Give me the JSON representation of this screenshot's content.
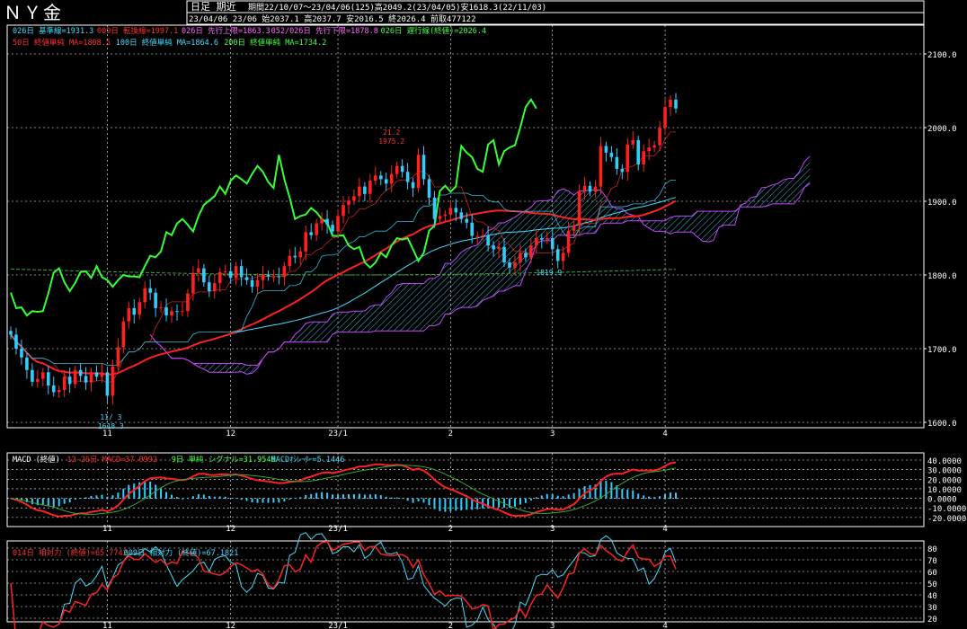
{
  "title": "ＮＹ金",
  "header": {
    "period_label": "日足 期近",
    "range_info": "期間22/10/07〜23/04/06(125)高2049.2(23/04/05)安1618.3(22/11/03)",
    "last_bar": "23/04/06 23/06 始2037.1 高2037.7 安2016.5 終2026.4 前取477122"
  },
  "indicators_row1": [
    {
      "text": "026日 基準線=1931.3",
      "color": "#44ddff"
    },
    {
      "text": "009日 転換線=1997.1",
      "color": "#ff3030"
    },
    {
      "text": "026日 先行上限=1863.3",
      "color": "#ff66ff"
    },
    {
      "text": "052/026日 先行下限=1878.8",
      "color": "#ff66ff"
    },
    {
      "text": "026日 遅行線(終値)=2026.4",
      "color": "#44ff44"
    }
  ],
  "indicators_row2": [
    {
      "text": "50日 終値単純 MA=1808.5",
      "color": "#ff3030"
    },
    {
      "text": "100日 終値単純 MA=1864.6",
      "color": "#44ddff"
    },
    {
      "text": "200日 終値単純 MA=1734.2",
      "color": "#44ff44"
    }
  ],
  "macd_legend": [
    {
      "text": "MACD (終値)",
      "color": "#ffffff"
    },
    {
      "text": "12-26日 MACD=37.0992",
      "color": "#ff3030"
    },
    {
      "text": "9日 単純 シグナル=31.9546",
      "color": "#44ff44"
    },
    {
      "text": "MACDｵｼﾚｰﾀｰ=5.1446",
      "color": "#44ddff"
    }
  ],
  "rsi_legend": [
    {
      "text": "014日 相対力 (終値)=65.7742",
      "color": "#ff3030"
    },
    {
      "text": "009日 相対力 (終値)=67.1821",
      "color": "#44ddff"
    }
  ],
  "annotations": [
    {
      "text": "11/ 3",
      "color": "#44ddff"
    },
    {
      "text": "1618.3",
      "color": "#44ddff"
    },
    {
      "text": "21.2",
      "color": "#ff3030"
    },
    {
      "text": "1975.2",
      "color": "#ff3030"
    },
    {
      "text": "1819.9",
      "color": "#44ddff"
    }
  ],
  "colors": {
    "up": "#ff2020",
    "down": "#33ccff",
    "kumo_line": "#cc44ff",
    "kumo_hatch": "#44ddff",
    "grid": "#ffffff"
  },
  "chart_data": [
    {
      "type": "candlestick",
      "title": "ＮＹ金",
      "x_tick_labels": [
        "11",
        "12",
        "23/1",
        "2",
        "3",
        "4"
      ],
      "y_tick_labels": [
        "2100.0",
        "2000.0",
        "1900.0",
        "1800.0",
        "1700.0",
        "1600.0"
      ],
      "ylim": [
        1600,
        2100
      ],
      "grid": true,
      "close": [
        1719,
        1700,
        1688,
        1671,
        1655,
        1659,
        1668,
        1650,
        1641,
        1644,
        1662,
        1652,
        1671,
        1663,
        1654,
        1668,
        1662,
        1668,
        1636,
        1676,
        1702,
        1737,
        1755,
        1746,
        1763,
        1782,
        1776,
        1755,
        1756,
        1745,
        1751,
        1750,
        1751,
        1775,
        1803,
        1809,
        1790,
        1778,
        1789,
        1804,
        1805,
        1796,
        1812,
        1797,
        1793,
        1784,
        1793,
        1800,
        1798,
        1798,
        1797,
        1812,
        1826,
        1824,
        1832,
        1858,
        1854,
        1870,
        1876,
        1868,
        1859,
        1880,
        1895,
        1901,
        1907,
        1920,
        1910,
        1928,
        1935,
        1930,
        1924,
        1937,
        1948,
        1940,
        1926,
        1918,
        1963,
        1930,
        1905,
        1876,
        1880,
        1882,
        1891,
        1885,
        1876,
        1871,
        1853,
        1853,
        1854,
        1840,
        1835,
        1838,
        1817,
        1810,
        1817,
        1830,
        1824,
        1840,
        1850,
        1848,
        1850,
        1835,
        1819,
        1830,
        1860,
        1867,
        1914,
        1921,
        1913,
        1920,
        1975,
        1966,
        1960,
        1944,
        1940,
        1977,
        1983,
        1950,
        1968,
        1973,
        1976,
        2000,
        2028,
        2038,
        2026
      ]
    },
    {
      "type": "line",
      "title": "MACD (終値)",
      "y_tick_labels": [
        "40.0000",
        "30.0000",
        "20.0000",
        "10.0000",
        "0.0000",
        "-10.0000",
        "-20.0000"
      ],
      "ylim": [
        -22,
        40
      ],
      "series": [
        {
          "name": "12-26日 MACD",
          "last": 37.0992
        },
        {
          "name": "9日 単純 シグナル",
          "last": 31.9546
        },
        {
          "name": "MACDｵｼﾚｰﾀｰ",
          "last": 5.1446
        }
      ]
    },
    {
      "type": "line",
      "title": "相対力 (終値)",
      "y_tick_labels": [
        "80",
        "70",
        "60",
        "50",
        "40",
        "30",
        "20"
      ],
      "ylim": [
        20,
        80
      ],
      "series": [
        {
          "name": "014日 相対力 (終値)",
          "last": 65.7742
        },
        {
          "name": "009日 相対力 (終値)",
          "last": 67.1821
        }
      ]
    }
  ]
}
